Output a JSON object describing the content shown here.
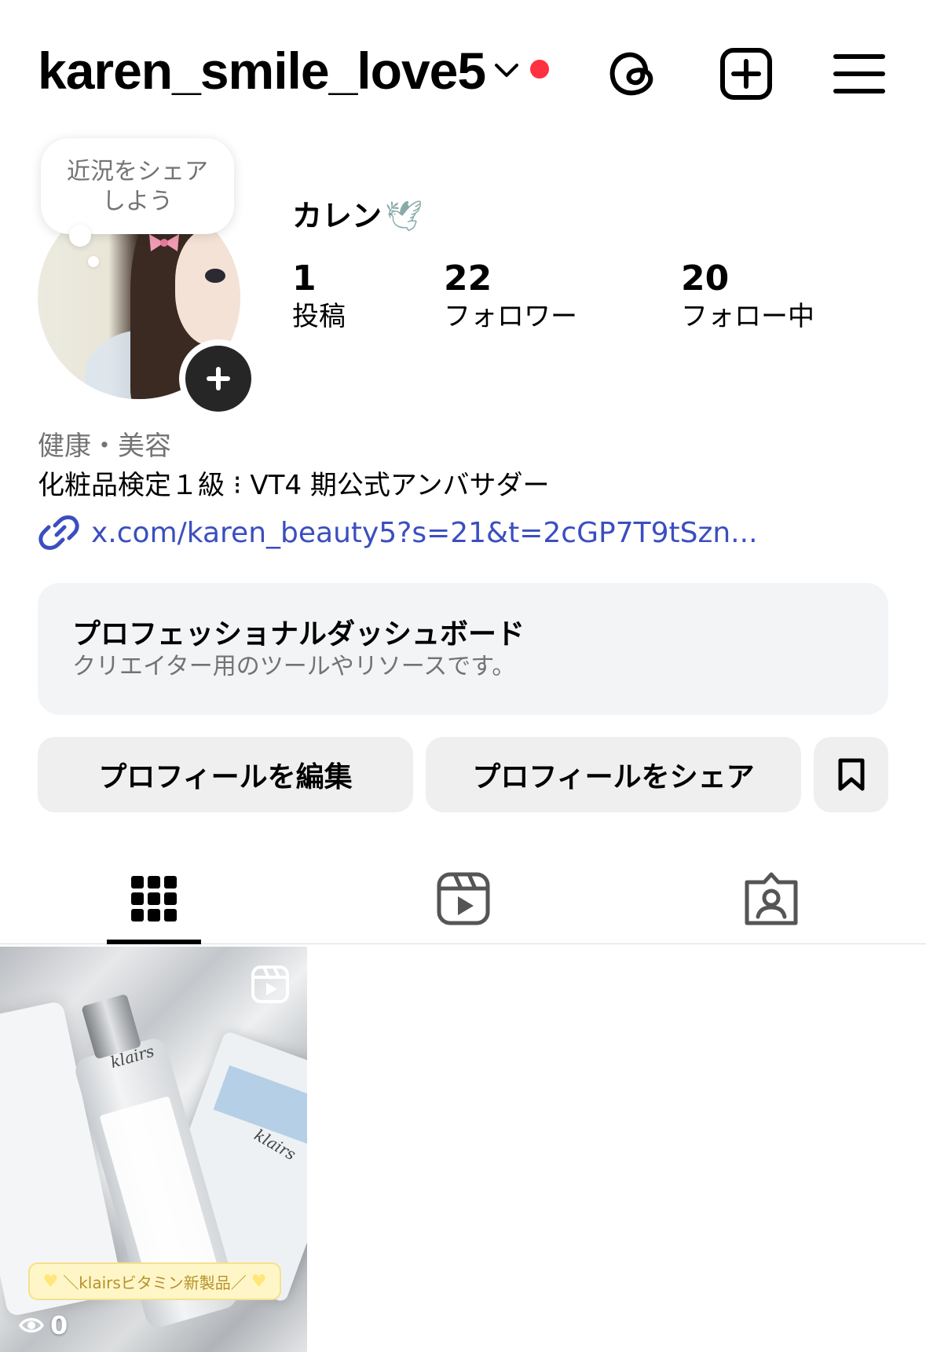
{
  "header": {
    "username": "karen_smile_love5",
    "icons": [
      "chevron-down-icon",
      "notification-dot",
      "threads-icon",
      "create-post-icon",
      "menu-icon"
    ],
    "notification_color": "#ff3040"
  },
  "profile": {
    "note": "近況をシェア\nしよう",
    "note_line1": "近況をシェア",
    "note_line2": "しよう",
    "display_name": "カレン",
    "display_name_emoji": "🕊",
    "stats": [
      {
        "value": "1",
        "label": "投稿"
      },
      {
        "value": "22",
        "label": "フォロワー"
      },
      {
        "value": "20",
        "label": "フォロー中"
      }
    ]
  },
  "bio": {
    "category": "健康・美容",
    "text": "化粧品検定１級 ⁝ VT4 期公式アンバサダー",
    "link": "x.com/karen_beauty5?s=21&t=2cGP7T9tSzn...",
    "link_color": "#3b4ec0"
  },
  "dashboard": {
    "title": "プロフェッショナルダッシュボード",
    "subtitle": "クリエイター用のツールやリソースです。"
  },
  "buttons": {
    "edit_profile": "プロフィールを編集",
    "share_profile": "プロフィールをシェア",
    "saved_icon": "bookmark-icon"
  },
  "tabs": [
    {
      "name": "posts",
      "icon": "grid-icon",
      "active": true
    },
    {
      "name": "reels",
      "icon": "reels-icon",
      "active": false
    },
    {
      "name": "tagged",
      "icon": "tagged-icon",
      "active": false
    }
  ],
  "posts": [
    {
      "type": "reel",
      "banner": "＼klairsビタミン新製品／",
      "views": "0",
      "brand_text": "klairs"
    }
  ]
}
